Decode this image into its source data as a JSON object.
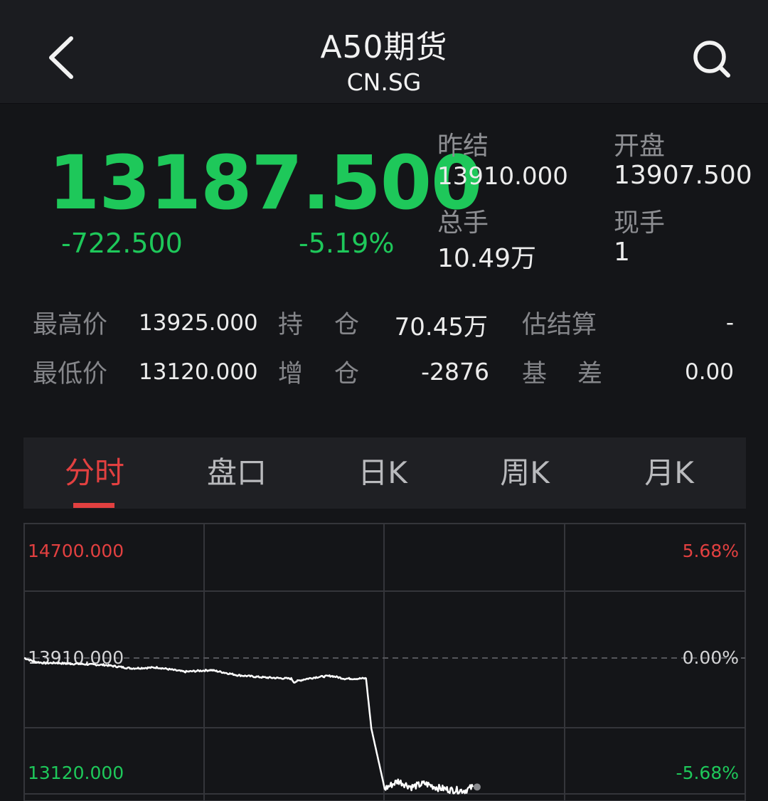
{
  "header": {
    "title": "A50期货",
    "subtitle": "CN.SG",
    "back_icon": "chevron-left-icon",
    "search_icon": "search-icon"
  },
  "quote": {
    "price": "13187.500",
    "change": "-722.500",
    "change_pct": "-5.19%",
    "color_down": "#1ec85a",
    "color_up": "#e24040"
  },
  "stats": {
    "prev_settle_label": "昨结",
    "prev_settle_value": "13910.000",
    "open_label": "开盘",
    "open_value": "13907.500",
    "volume_label": "总手",
    "volume_value": "10.49万",
    "last_lot_label": "现手",
    "last_lot_value": "1"
  },
  "details": {
    "high_label": "最高价",
    "high_value": "13925.000",
    "low_label": "最低价",
    "low_value": "13120.000",
    "open_interest_label_a": "持",
    "open_interest_label_b": "仓",
    "open_interest_value": "70.45万",
    "oi_change_label_a": "增",
    "oi_change_label_b": "仓",
    "oi_change_value": "-2876",
    "est_settle_label": "估结算",
    "est_settle_value": "-",
    "basis_label_a": "基",
    "basis_label_b": "差",
    "basis_value": "0.00"
  },
  "tabs": [
    {
      "label": "分时",
      "active": true
    },
    {
      "label": "盘口",
      "active": false
    },
    {
      "label": "日K",
      "active": false
    },
    {
      "label": "周K",
      "active": false
    },
    {
      "label": "月K",
      "active": false
    }
  ],
  "chart_data": {
    "type": "line",
    "ylim": [
      13120,
      14700
    ],
    "y_tick_labels_left": [
      "14700.000",
      "13910.000",
      "13120.000"
    ],
    "y_tick_labels_right": [
      "5.68%",
      "0.00%",
      "-5.68%"
    ],
    "reference_value": 13910,
    "reference_line_style": "dashed",
    "grid": true,
    "series": [
      {
        "x": [
          0,
          4,
          8,
          12,
          16,
          20,
          25,
          30,
          40,
          50,
          60,
          70,
          80,
          90,
          100,
          101,
          105,
          110,
          115,
          120,
          125,
          128,
          130,
          135,
          140,
          145,
          150,
          155,
          160,
          165,
          168
        ],
        "values": [
          13910,
          13888,
          13880,
          13882,
          13877,
          13876,
          13872,
          13870,
          13850,
          13855,
          13830,
          13840,
          13810,
          13797,
          13790,
          13770,
          13787,
          13800,
          13806,
          13790,
          13790,
          13792,
          13500,
          13150,
          13195,
          13160,
          13180,
          13155,
          13143,
          13140,
          13160
        ],
        "color": "#ffffff"
      }
    ],
    "x_total": 270,
    "last_point_marker": true
  }
}
